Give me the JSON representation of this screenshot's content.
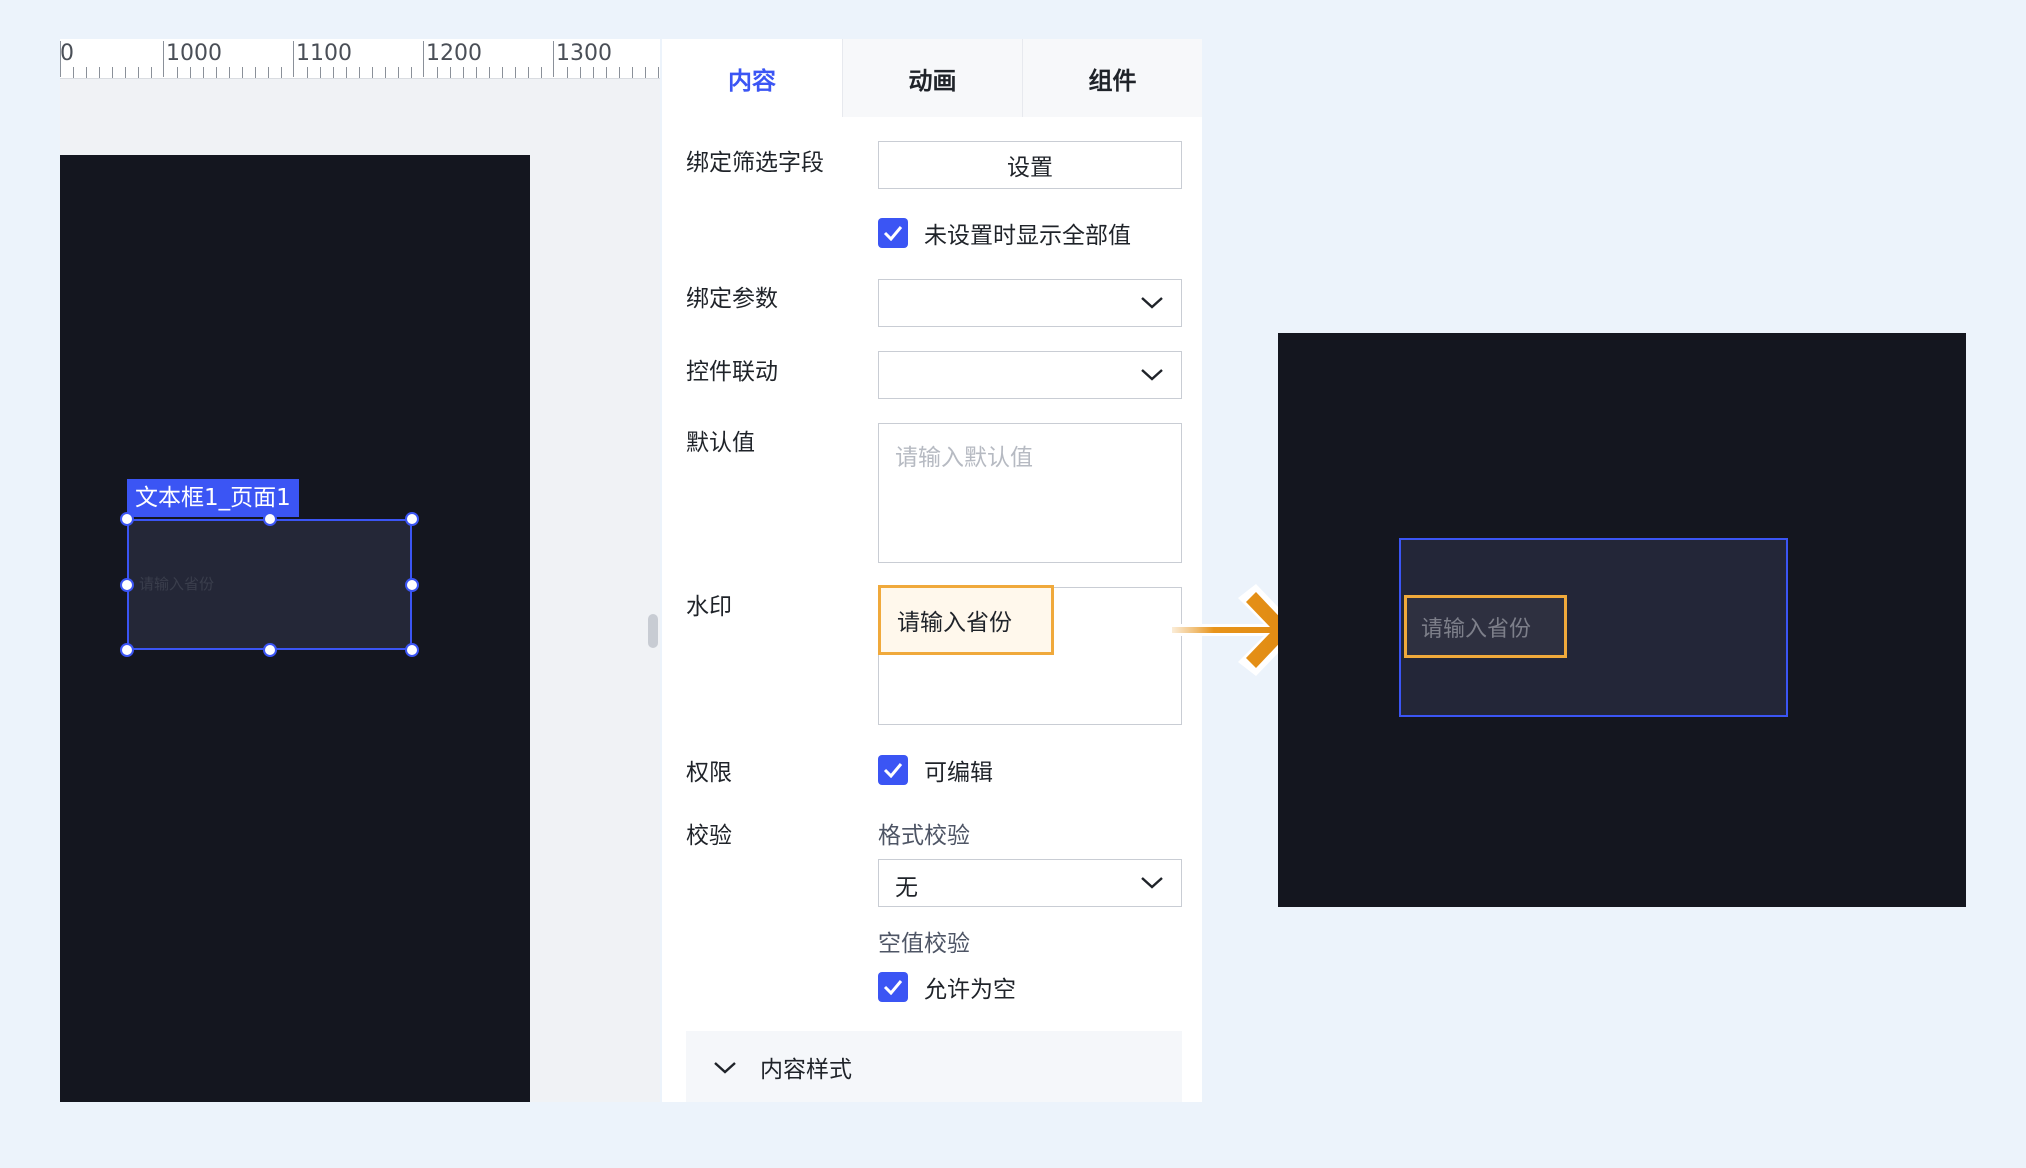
{
  "ruler": {
    "labels": [
      "0",
      "1000",
      "1100",
      "1200",
      "1300"
    ]
  },
  "canvas": {
    "selection_tag": "文本框1_页面1",
    "tiny_placeholder": "请输入省份"
  },
  "panel": {
    "tabs": [
      {
        "label": "内容",
        "active": true
      },
      {
        "label": "动画",
        "active": false
      },
      {
        "label": "组件",
        "active": false
      }
    ],
    "bind_filter_field": {
      "label": "绑定筛选字段",
      "button": "设置"
    },
    "show_all_when_unset": {
      "label": "未设置时显示全部值",
      "checked": true
    },
    "bind_param": {
      "label": "绑定参数",
      "value": ""
    },
    "control_link": {
      "label": "控件联动",
      "value": ""
    },
    "default_value": {
      "label": "默认值",
      "placeholder": "请输入默认值"
    },
    "watermark": {
      "label": "水印",
      "value": "请输入省份"
    },
    "permission": {
      "label": "权限",
      "editable_label": "可编辑",
      "checked": true
    },
    "validation": {
      "label": "校验",
      "format_label": "格式校验",
      "format_value": "无",
      "empty_label": "空值校验",
      "allow_empty_label": "允许为空",
      "allow_empty_checked": true
    },
    "content_style": {
      "label": "内容样式"
    }
  },
  "preview": {
    "input_placeholder": "请输入省份"
  },
  "colors": {
    "accent": "#3b55f4",
    "highlight": "#f0a93b",
    "canvas_dark": "#14161f"
  }
}
